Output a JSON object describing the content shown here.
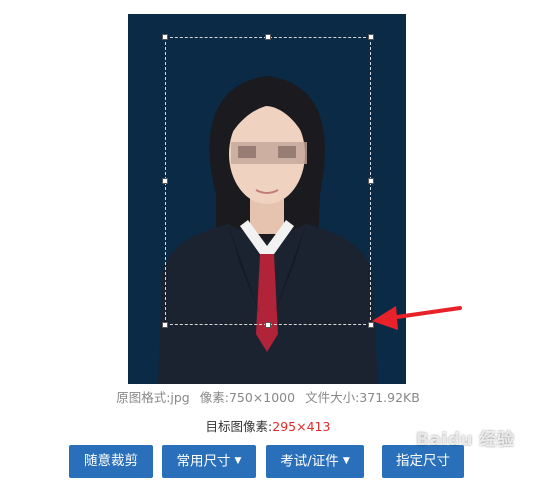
{
  "photo": {
    "background_color": "#0b2a45",
    "crop_fill_color": "#0a97f5"
  },
  "info": {
    "format": "原图格式:jpg",
    "pixels": "像素:750×1000",
    "filesize": "文件大小:371.92KB"
  },
  "target": {
    "label": "目标图像素:",
    "value": "295×413",
    "value_color": "#e02a2a"
  },
  "buttons": {
    "free_crop": "随意裁剪",
    "common_sizes": "常用尺寸",
    "exam_id": "考试/证件",
    "custom_size": "指定尺寸"
  },
  "icons": {
    "dropdown": "chevron-down-icon"
  },
  "accent_color": "#2a6fba",
  "watermark": "Baidu 经验"
}
